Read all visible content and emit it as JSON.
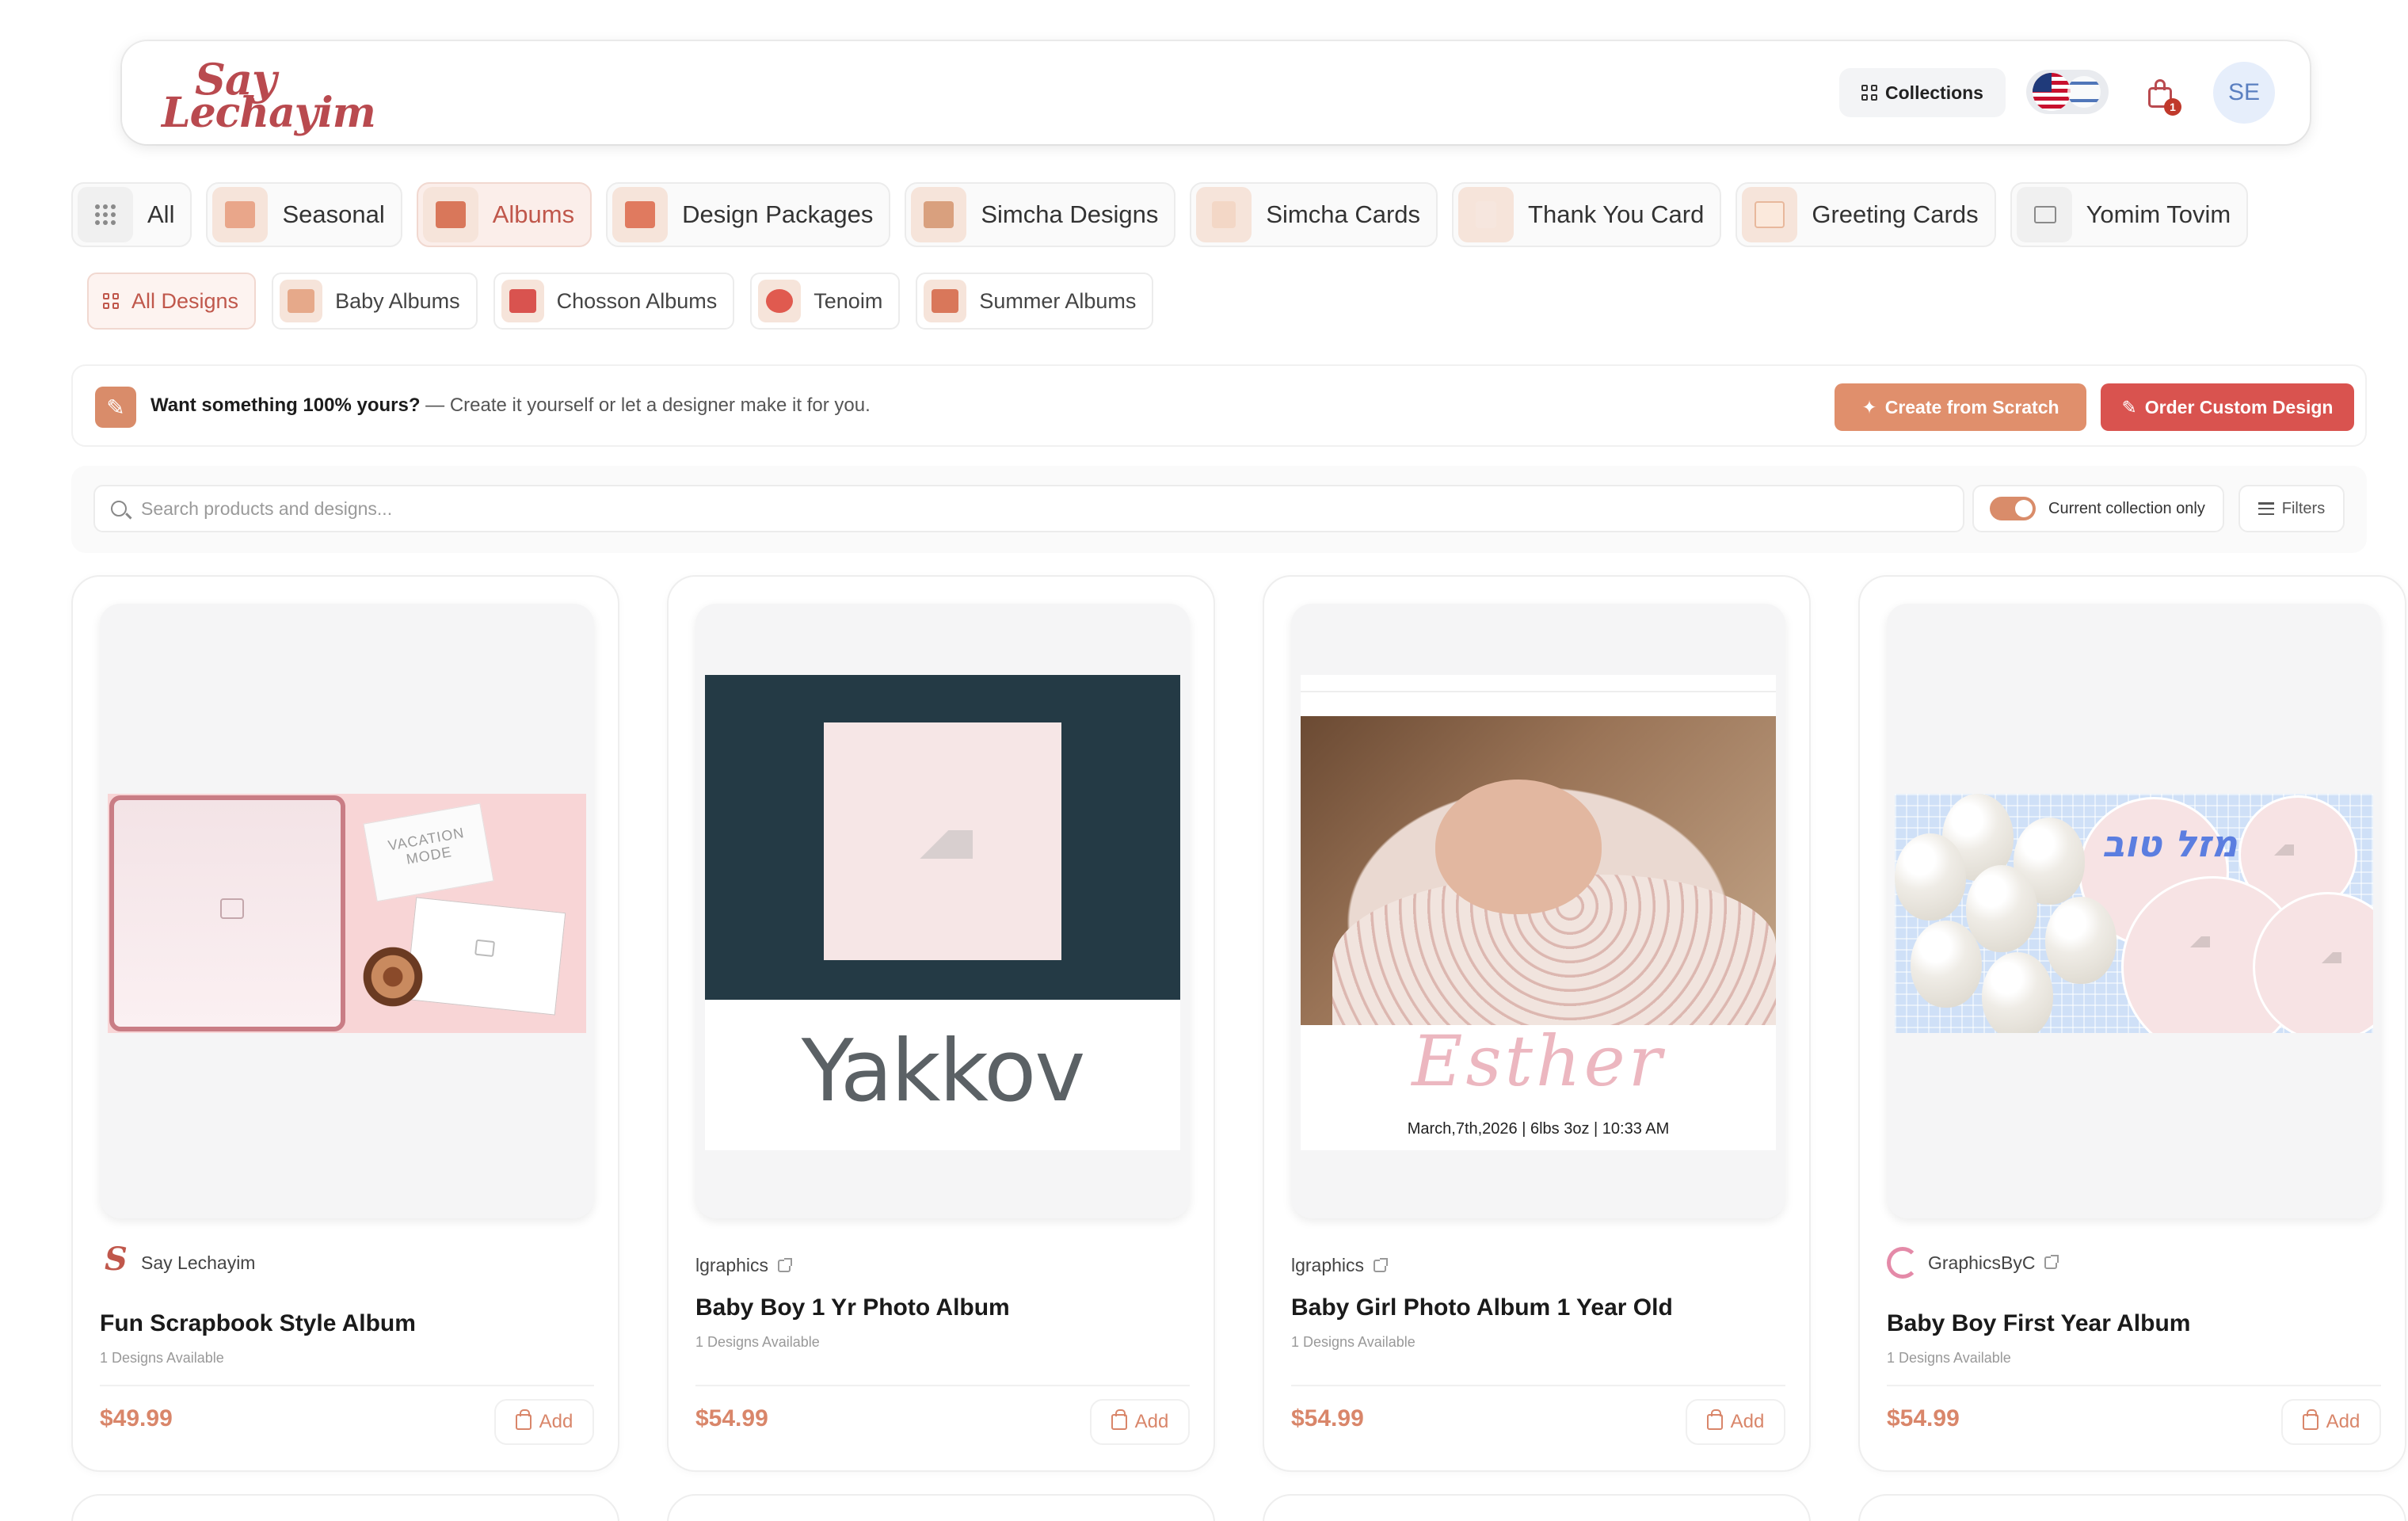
{
  "header": {
    "logo_line1": "Say",
    "logo_line2": "Lechayim",
    "collections_label": "Collections",
    "cart_count": "1",
    "avatar_initials": "SE"
  },
  "categories": [
    {
      "label": "All",
      "icon": "grid-dots-icon"
    },
    {
      "label": "Seasonal",
      "icon": "seasonal-thumb"
    },
    {
      "label": "Albums",
      "icon": "albums-thumb",
      "active": true
    },
    {
      "label": "Design Packages",
      "icon": "design-packages-thumb"
    },
    {
      "label": "Simcha Designs",
      "icon": "simcha-designs-thumb"
    },
    {
      "label": "Simcha Cards",
      "icon": "simcha-cards-thumb"
    },
    {
      "label": "Thank You Card",
      "icon": "thank-you-card-thumb"
    },
    {
      "label": "Greeting Cards",
      "icon": "greeting-cards-thumb"
    },
    {
      "label": "Yomim Tovim",
      "icon": "folder-icon"
    }
  ],
  "subcategories": [
    {
      "label": "All Designs",
      "icon": "grid-icon",
      "active": true
    },
    {
      "label": "Baby Albums",
      "icon": "baby-albums-thumb"
    },
    {
      "label": "Chosson Albums",
      "icon": "chosson-albums-thumb"
    },
    {
      "label": "Tenoim",
      "icon": "tenoim-thumb"
    },
    {
      "label": "Summer Albums",
      "icon": "summer-albums-thumb"
    }
  ],
  "promo": {
    "headline": "Want something 100% yours?",
    "subtext": " — Create it yourself or let a designer make it for you.",
    "create_label": "Create from Scratch",
    "order_label": "Order Custom Design"
  },
  "search": {
    "placeholder": "Search products and designs...",
    "toggle_label": "Current collection only",
    "toggle_on": true,
    "filters_label": "Filters"
  },
  "products": [
    {
      "brand": "Say Lechayim",
      "title": "Fun Scrapbook Style Album",
      "availability": "1 Designs Available",
      "price": "$49.99",
      "add_label": "Add",
      "preview_note": "VACATION MODE"
    },
    {
      "brand": "lgraphics",
      "title": "Baby Boy 1 Yr Photo Album",
      "availability": "1 Designs Available",
      "price": "$54.99",
      "add_label": "Add",
      "preview_name": "Yakkov"
    },
    {
      "brand": "lgraphics",
      "title": "Baby Girl Photo Album 1 Year Old",
      "availability": "1 Designs Available",
      "price": "$54.99",
      "add_label": "Add",
      "preview_name": "Esther",
      "preview_meta": "March,7th,2026 | 6lbs 3oz | 10:33 AM"
    },
    {
      "brand": "GraphicsByC",
      "title": "Baby Boy First Year Album",
      "availability": "1 Designs Available",
      "price": "$54.99",
      "add_label": "Add",
      "preview_hebrew": "מזל טוב"
    }
  ],
  "colors": {
    "brand": "#b94a4f",
    "accent": "#d98c6a",
    "order_button": "#d9534f",
    "price": "#d9866a"
  }
}
